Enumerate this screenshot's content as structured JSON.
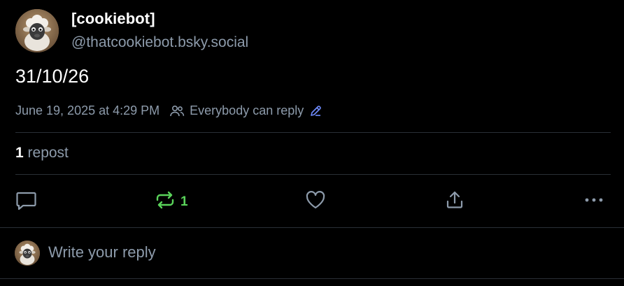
{
  "author": {
    "display_name": "[cookiebot]",
    "handle": "@thatcookiebot.bsky.social"
  },
  "post": {
    "text": "31/10/26",
    "timestamp": "June 19, 2025 at 4:29 PM",
    "reply_setting": "Everybody can reply"
  },
  "stats": {
    "repost_count": "1",
    "repost_label": "repost"
  },
  "actions": {
    "reply_icon": "speech-bubble-icon",
    "repost_icon": "repost-arrows-icon",
    "repost_count": "1",
    "like_icon": "heart-icon",
    "share_icon": "share-up-icon",
    "more_icon": "ellipsis-icon"
  },
  "reply_box": {
    "placeholder": "Write your reply"
  },
  "colors": {
    "background": "#000000",
    "muted_text": "#8d9bab",
    "repost_accent": "#5ad35a",
    "edit_accent": "#6f8cff",
    "divider": "#2a2f36"
  }
}
